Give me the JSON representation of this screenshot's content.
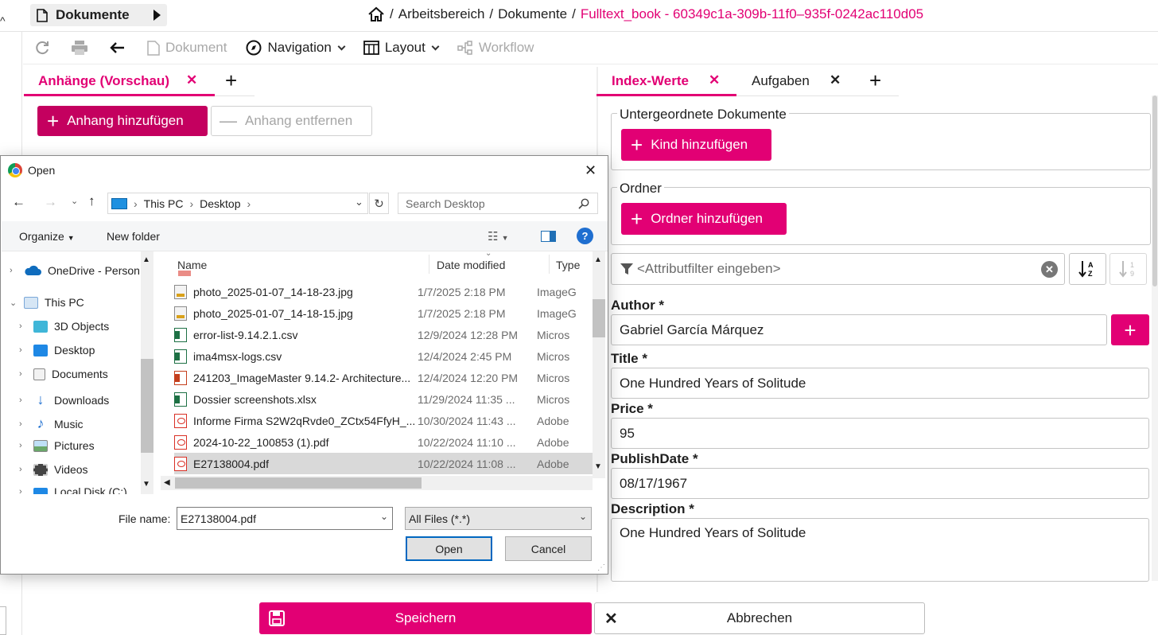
{
  "header": {
    "doc_tab_label": "Dokumente",
    "breadcrumb": {
      "workspace": "Arbeitsbereich",
      "sep": "/",
      "docs": "Dokumente",
      "current": "Fulltext_book - 60349c1a-309b-11f0–935f-0242ac110d05"
    }
  },
  "toolbar": {
    "document": "Dokument",
    "navigation": "Navigation",
    "layout": "Layout",
    "workflow": "Workflow"
  },
  "left_pane": {
    "tab_label": "Anhänge (Vorschau)",
    "add_attachment": "Anhang hinzufügen",
    "remove_attachment": "Anhang entfernen"
  },
  "right_pane": {
    "tabs": [
      {
        "label": "Index-Werte"
      },
      {
        "label": "Aufgaben"
      }
    ],
    "child_docs_legend": "Untergeordnete Dokumente",
    "add_child": "Kind hinzufügen",
    "folder_legend": "Ordner",
    "add_folder": "Ordner hinzufügen",
    "filter_placeholder": "<Attributfilter eingeben>",
    "fields": [
      {
        "label": "Author *",
        "value": "Gabriel García Márquez"
      },
      {
        "label": "Title *",
        "value": "One Hundred Years of Solitude"
      },
      {
        "label": "Price *",
        "value": "95"
      },
      {
        "label": "PublishDate *",
        "value": "08/17/1967"
      },
      {
        "label": "Description *",
        "value": "One Hundred Years of Solitude"
      }
    ]
  },
  "footer": {
    "save": "Speichern",
    "cancel": "Abbrechen"
  },
  "dialog": {
    "title": "Open",
    "path": [
      "This PC",
      "Desktop"
    ],
    "search_placeholder": "Search Desktop",
    "organize": "Organize",
    "new_folder": "New folder",
    "columns": {
      "name": "Name",
      "date": "Date modified",
      "type": "Type"
    },
    "nav": [
      {
        "label": "OneDrive - Person",
        "icon": "cloud-icon"
      },
      {
        "label": "This PC",
        "icon": "computer-icon"
      },
      {
        "label": "3D Objects",
        "icon": "cube-icon"
      },
      {
        "label": "Desktop",
        "icon": "desktop-icon"
      },
      {
        "label": "Documents",
        "icon": "documents-icon"
      },
      {
        "label": "Downloads",
        "icon": "download-icon"
      },
      {
        "label": "Music",
        "icon": "music-icon"
      },
      {
        "label": "Pictures",
        "icon": "pictures-icon"
      },
      {
        "label": "Videos",
        "icon": "videos-icon"
      },
      {
        "label": "Local Disk (C:)",
        "icon": "disk-icon"
      }
    ],
    "files": [
      {
        "name": "photo_2025-01-07_14-18-23.jpg",
        "date": "1/7/2025 2:18 PM",
        "type": "ImageG",
        "icon": "jpg"
      },
      {
        "name": "photo_2025-01-07_14-18-15.jpg",
        "date": "1/7/2025 2:18 PM",
        "type": "ImageG",
        "icon": "jpg"
      },
      {
        "name": "error-list-9.14.2.1.csv",
        "date": "12/9/2024 12:28 PM",
        "type": "Micros",
        "icon": "xls"
      },
      {
        "name": "ima4msx-logs.csv",
        "date": "12/4/2024 2:45 PM",
        "type": "Micros",
        "icon": "xls"
      },
      {
        "name": "241203_ImageMaster 9.14.2- Architecture...",
        "date": "12/4/2024 12:20 PM",
        "type": "Micros",
        "icon": "ppt"
      },
      {
        "name": "Dossier screenshots.xlsx",
        "date": "11/29/2024 11:35 ...",
        "type": "Micros",
        "icon": "xls"
      },
      {
        "name": "Informe Firma S2W2qRvde0_ZCtx54FfyH_...",
        "date": "10/30/2024 11:43 ...",
        "type": "Adobe",
        "icon": "pdf"
      },
      {
        "name": "2024-10-22_100853 (1).pdf",
        "date": "10/22/2024 11:10 ...",
        "type": "Adobe",
        "icon": "pdf"
      },
      {
        "name": "E27138004.pdf",
        "date": "10/22/2024 11:08 ...",
        "type": "Adobe",
        "icon": "pdf",
        "selected": true
      }
    ],
    "filename_label": "File name:",
    "filename_value": "E27138004.pdf",
    "filetype": "All Files (*.*)",
    "open": "Open",
    "cancel": "Cancel"
  },
  "colors": {
    "brand": "#e20074",
    "brand_dark": "#c4005f"
  }
}
